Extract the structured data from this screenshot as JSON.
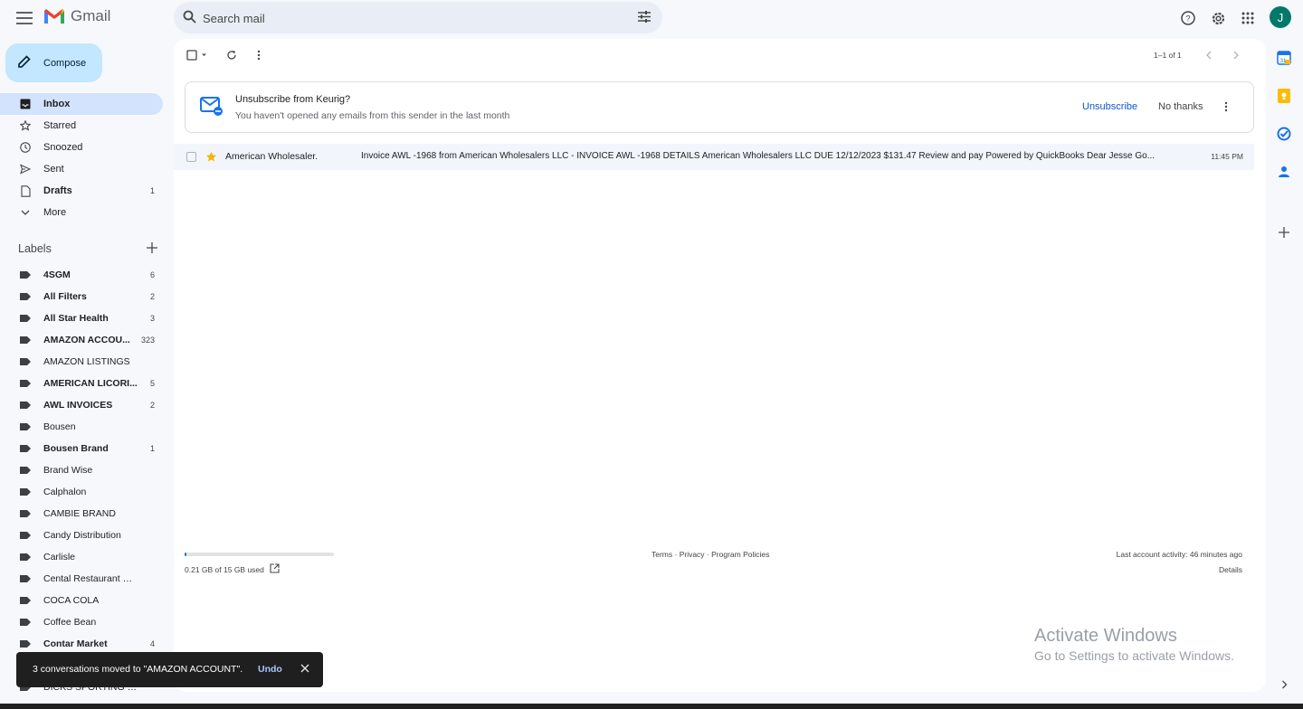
{
  "header": {
    "app_name": "Gmail",
    "search_placeholder": "Search mail",
    "avatar_letter": "J"
  },
  "compose_label": "Compose",
  "nav": [
    {
      "label": "Inbox",
      "count": "",
      "icon": "inbox-icon",
      "active": true
    },
    {
      "label": "Starred",
      "count": "",
      "icon": "star-icon"
    },
    {
      "label": "Snoozed",
      "count": "",
      "icon": "clock-icon"
    },
    {
      "label": "Sent",
      "count": "",
      "icon": "send-icon"
    },
    {
      "label": "Drafts",
      "count": "1",
      "icon": "draft-icon"
    },
    {
      "label": "More",
      "count": "",
      "icon": "chevron-down-icon"
    }
  ],
  "labels_heading": "Labels",
  "labels": [
    {
      "name": "4SGM",
      "count": "6",
      "bold": true
    },
    {
      "name": "All Filters",
      "count": "2",
      "bold": true
    },
    {
      "name": "All Star Health",
      "count": "3",
      "bold": true
    },
    {
      "name": "AMAZON ACCOU...",
      "count": "323",
      "bold": true
    },
    {
      "name": "AMAZON LISTINGS",
      "count": "",
      "bold": false
    },
    {
      "name": "AMERICAN LICORI...",
      "count": "5",
      "bold": true
    },
    {
      "name": "AWL INVOICES",
      "count": "2",
      "bold": true
    },
    {
      "name": "Bousen",
      "count": "",
      "bold": false
    },
    {
      "name": "Bousen Brand",
      "count": "1",
      "bold": true
    },
    {
      "name": "Brand Wise",
      "count": "",
      "bold": false
    },
    {
      "name": "Calphalon",
      "count": "",
      "bold": false
    },
    {
      "name": "CAMBIE BRAND",
      "count": "",
      "bold": false
    },
    {
      "name": "Candy Distribution",
      "count": "",
      "bold": false
    },
    {
      "name": "Carlisle",
      "count": "",
      "bold": false
    },
    {
      "name": "Cental Restaurant Quot...",
      "count": "",
      "bold": false
    },
    {
      "name": "COCA COLA",
      "count": "",
      "bold": false
    },
    {
      "name": "Coffee Bean",
      "count": "",
      "bold": false
    },
    {
      "name": "Contar Market",
      "count": "4",
      "bold": true
    },
    {
      "name": "",
      "count": "",
      "bold": false
    },
    {
      "name": "DICKS SPORTING GOODS",
      "count": "",
      "bold": false
    }
  ],
  "toolbar": {
    "pager": "1–1 of 1"
  },
  "banner": {
    "title": "Unsubscribe from Keurig?",
    "subtitle": "You haven't opened any emails from this sender in the last month",
    "unsubscribe": "Unsubscribe",
    "no_thanks": "No thanks"
  },
  "emails": [
    {
      "sender": "American Wholesaler.",
      "subject": "Invoice AWL -1968 from American Wholesalers LLC - INVOICE AWL -1968 DETAILS American Wholesalers LLC DUE 12/12/2023 $131.47 Review and pay Powered by QuickBooks Dear Jesse Go...",
      "time": "11:45 PM",
      "starred": true
    }
  ],
  "footer": {
    "storage": "0.21 GB of 15 GB used",
    "storage_fraction": 0.014,
    "links": "Terms · Privacy · Program Policies",
    "activity": "Last account activity: 46 minutes ago",
    "details": "Details"
  },
  "watermark": {
    "line1": "Activate Windows",
    "line2": "Go to Settings to activate Windows."
  },
  "toast": {
    "message": "3 conversations moved to \"AMAZON ACCOUNT\".",
    "undo": "Undo"
  },
  "colors": {
    "accent": "#0b57d0",
    "compose_bg": "#c2e7ff",
    "active_nav": "#d3e3fd",
    "star": "#f4b400",
    "avatar": "#00796b"
  }
}
